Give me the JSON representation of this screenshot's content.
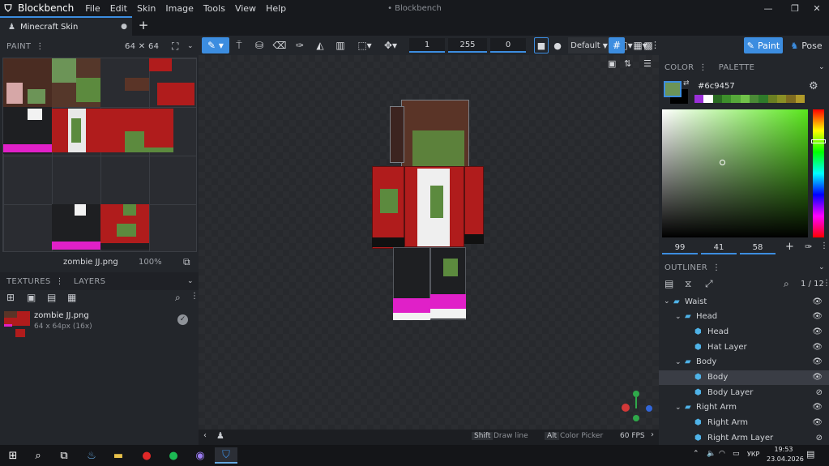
{
  "titlebar": {
    "app_name": "Blockbench",
    "menus": [
      "File",
      "Edit",
      "Skin",
      "Image",
      "Tools",
      "View",
      "Help"
    ],
    "window_title": "• Blockbench"
  },
  "tabs": [
    {
      "label": "Minecraft Skin",
      "modified_dot": "●"
    }
  ],
  "paint_panel": {
    "title": "PAINT",
    "size": "64 ✕ 64",
    "texture_name": "zombie JJ.png",
    "zoom": "100%"
  },
  "textures_panel": {
    "tabs": [
      "TEXTURES",
      "LAYERS"
    ],
    "items": [
      {
        "name": "zombie JJ.png",
        "meta": "64 x 64px (16x)"
      }
    ]
  },
  "toolbar": {
    "size_value": "1",
    "opacity_value": "255",
    "softness_value": "0",
    "blend_mode": "Default"
  },
  "mode_tabs": [
    "Paint",
    "Pose"
  ],
  "color_panel": {
    "tabs": [
      "COLOR",
      "PALETTE"
    ],
    "hex": "#6c9457",
    "current_color": "#6c9457",
    "hsv": [
      "99",
      "41",
      "58"
    ],
    "palette_swatches": [
      "#9b30d9",
      "#ffffff",
      "#2a6b22",
      "#3d8f2b",
      "#56a83a",
      "#71c24a",
      "#4a8a36",
      "#2f7b2a",
      "#6b7f22",
      "#8a8f25",
      "#7e6b20",
      "#b09a2a"
    ]
  },
  "outliner": {
    "title": "OUTLINER",
    "count": "1 / 12",
    "items": [
      {
        "label": "Waist",
        "type": "group",
        "depth": 0,
        "eye": "👁"
      },
      {
        "label": "Head",
        "type": "group",
        "depth": 1,
        "eye": "👁"
      },
      {
        "label": "Head",
        "type": "cube",
        "depth": 2,
        "eye": "👁"
      },
      {
        "label": "Hat Layer",
        "type": "cube",
        "depth": 2,
        "eye": "👁"
      },
      {
        "label": "Body",
        "type": "group",
        "depth": 1,
        "eye": "👁"
      },
      {
        "label": "Body",
        "type": "cube",
        "depth": 2,
        "eye": "👁",
        "selected": true
      },
      {
        "label": "Body Layer",
        "type": "cube",
        "depth": 2,
        "eye": "⊘"
      },
      {
        "label": "Right Arm",
        "type": "group",
        "depth": 1,
        "eye": "👁"
      },
      {
        "label": "Right Arm",
        "type": "cube",
        "depth": 2,
        "eye": "👁"
      },
      {
        "label": "Right Arm Layer",
        "type": "cube",
        "depth": 2,
        "eye": "⊘"
      }
    ]
  },
  "statusbar": {
    "shift_key": "Shift",
    "shift_action": "Draw line",
    "alt_key": "Alt",
    "alt_action": "Color Picker",
    "fps": "60 FPS"
  },
  "taskbar": {
    "language": "УКР",
    "time": "19:53",
    "date": "23.04.2026"
  },
  "colors": {
    "accent": "#3c8de0",
    "skin_red": "#b01c1c",
    "skin_green": "#5c8a3e",
    "skin_brown": "#5a3427",
    "skin_magenta": "#e020c8"
  }
}
